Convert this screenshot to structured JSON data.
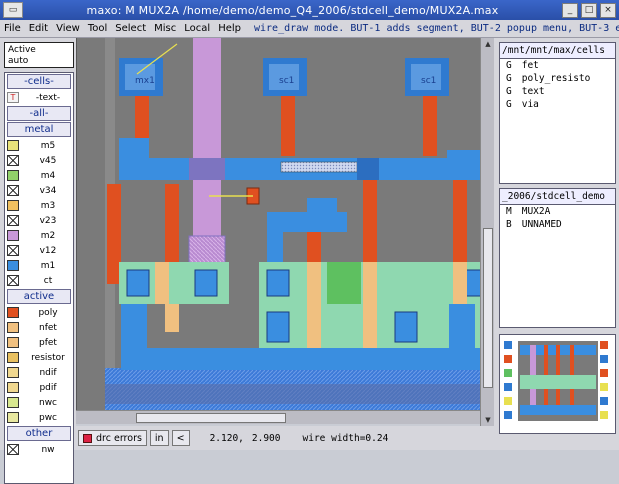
{
  "window": {
    "title": "maxo:  M  MUX2A  /home/demo/demo_Q4_2006/stdcell_demo/MUX2A.max"
  },
  "menu": [
    "File",
    "Edit",
    "View",
    "Tool",
    "Select",
    "Misc",
    "Local",
    "Help"
  ],
  "status_line": "wire_draw mode. BUT-1 adds segment, BUT-2 popup menu, BUT-3 e",
  "active": {
    "line1": "Active",
    "line2": "auto"
  },
  "layers": {
    "cells_label": "-cells-",
    "text_label": "-text-",
    "all_label": "-all-",
    "metal_label": "metal",
    "metal_items": [
      {
        "label": "m5",
        "color": "#e8e27a"
      },
      {
        "label": "v45",
        "color": "#ffffff"
      },
      {
        "label": "m4",
        "color": "#92d16a"
      },
      {
        "label": "v34",
        "color": "#ffffff"
      },
      {
        "label": "m3",
        "color": "#f0c060"
      },
      {
        "label": "v23",
        "color": "#ffffff"
      },
      {
        "label": "m2",
        "color": "#c898d8"
      },
      {
        "label": "v12",
        "color": "#ffffff"
      },
      {
        "label": "m1",
        "color": "#3a8ee0"
      },
      {
        "label": "ct",
        "color": "#ffffff"
      }
    ],
    "active_label": "active",
    "active_items": [
      {
        "label": "poly",
        "color": "#e05020"
      },
      {
        "label": "nfet",
        "color": "#f0c080"
      },
      {
        "label": "pfet",
        "color": "#f0c080"
      },
      {
        "label": "resistor",
        "color": "#e8c060"
      },
      {
        "label": "ndif",
        "color": "#f0d890"
      },
      {
        "label": "pdif",
        "color": "#f0d890"
      },
      {
        "label": "nwc",
        "color": "#d8e890"
      },
      {
        "label": "pwc",
        "color": "#e8e8a0"
      }
    ],
    "other_label": "other",
    "other_items": [
      {
        "label": "nw",
        "color": "#ffffff"
      }
    ]
  },
  "cell_lib": {
    "header": "/mnt/mnt/max/cells",
    "items": [
      {
        "tag": "G",
        "name": "fet"
      },
      {
        "tag": "G",
        "name": "poly_resisto"
      },
      {
        "tag": "G",
        "name": "text"
      },
      {
        "tag": "G",
        "name": "via"
      }
    ]
  },
  "design_lib": {
    "header": "_2006/stdcell_demo",
    "items": [
      {
        "tag": "M",
        "name": "MUX2A"
      },
      {
        "tag": "B",
        "name": "UNNAMED"
      }
    ]
  },
  "bottom": {
    "drc_label": "drc errors",
    "in_label": "in",
    "lt_label": "<",
    "x": "2.120,",
    "y": "2.900",
    "wire_width": "wire width=0.24"
  },
  "canvas_labels": {
    "cell_a": "mx1",
    "cell_b": "sc1",
    "cell_c": "sc1"
  },
  "colors": {
    "metal1": "#3a8ee0",
    "metal2": "#c898d8",
    "poly": "#e05020",
    "diffusion": "#8fd8b0",
    "nwell": "#3c7ad8",
    "background": "#7a7a7a"
  }
}
